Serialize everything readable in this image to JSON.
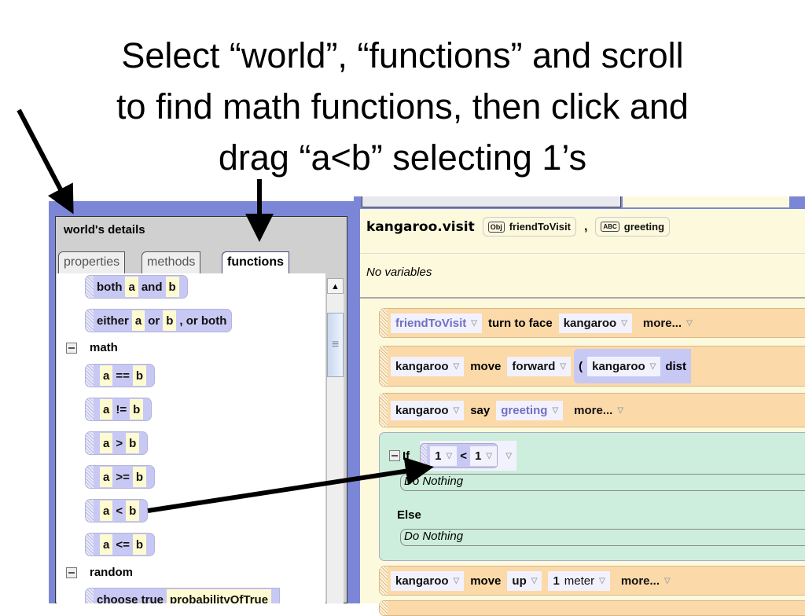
{
  "slide": {
    "lines": [
      "Select “world”, “functions” and scroll",
      "to find math functions, then click and",
      "drag “a<b” selecting 1’s"
    ]
  },
  "details": {
    "title": "world's details",
    "tabs": [
      "properties",
      "methods",
      "functions"
    ],
    "active_tab": "functions",
    "logic_items": [
      {
        "parts": [
          "both",
          "a",
          "and",
          "b"
        ]
      },
      {
        "parts": [
          "either",
          "a",
          "or",
          "b",
          ", or both"
        ]
      }
    ],
    "math_label": "math",
    "math_items": [
      {
        "a": "a",
        "op": "==",
        "b": "b"
      },
      {
        "a": "a",
        "op": "!=",
        "b": "b"
      },
      {
        "a": "a",
        "op": ">",
        "b": "b"
      },
      {
        "a": "a",
        "op": ">=",
        "b": "b"
      },
      {
        "a": "a",
        "op": "<",
        "b": "b"
      },
      {
        "a": "a",
        "op": "<=",
        "b": "b"
      }
    ],
    "random_label": "random",
    "random_item": [
      "choose true",
      "probabilityOfTrue"
    ]
  },
  "editor": {
    "method": "kangaroo.visit",
    "params": [
      {
        "icon": "Obj",
        "name": "friendToVisit"
      },
      {
        "icon": "ABC",
        "name": "greeting"
      }
    ],
    "comma": ",",
    "variables": "No variables",
    "rows": {
      "turn": [
        "friendToVisit",
        "turn to face",
        "kangaroo",
        "more..."
      ],
      "move": [
        "kangaroo",
        "move",
        "forward",
        "(",
        "kangaroo",
        "dist"
      ],
      "say": [
        "kangaroo",
        "say",
        "greeting",
        "more..."
      ],
      "if": {
        "label": "If",
        "a": "1",
        "op": "<",
        "b": "1",
        "then": "Do Nothing",
        "else_label": "Else",
        "else": "Do Nothing"
      },
      "up": [
        "kangaroo",
        "move",
        "up",
        "1",
        "meter",
        "more..."
      ]
    }
  },
  "colors": {
    "frame": "#7b87d6",
    "logic_tile": "#c8c8f4",
    "slot": "#fffbd0",
    "statement": "#fbd9a8",
    "if_block": "#cdeedc",
    "editor_bg": "#fdf9dc"
  }
}
